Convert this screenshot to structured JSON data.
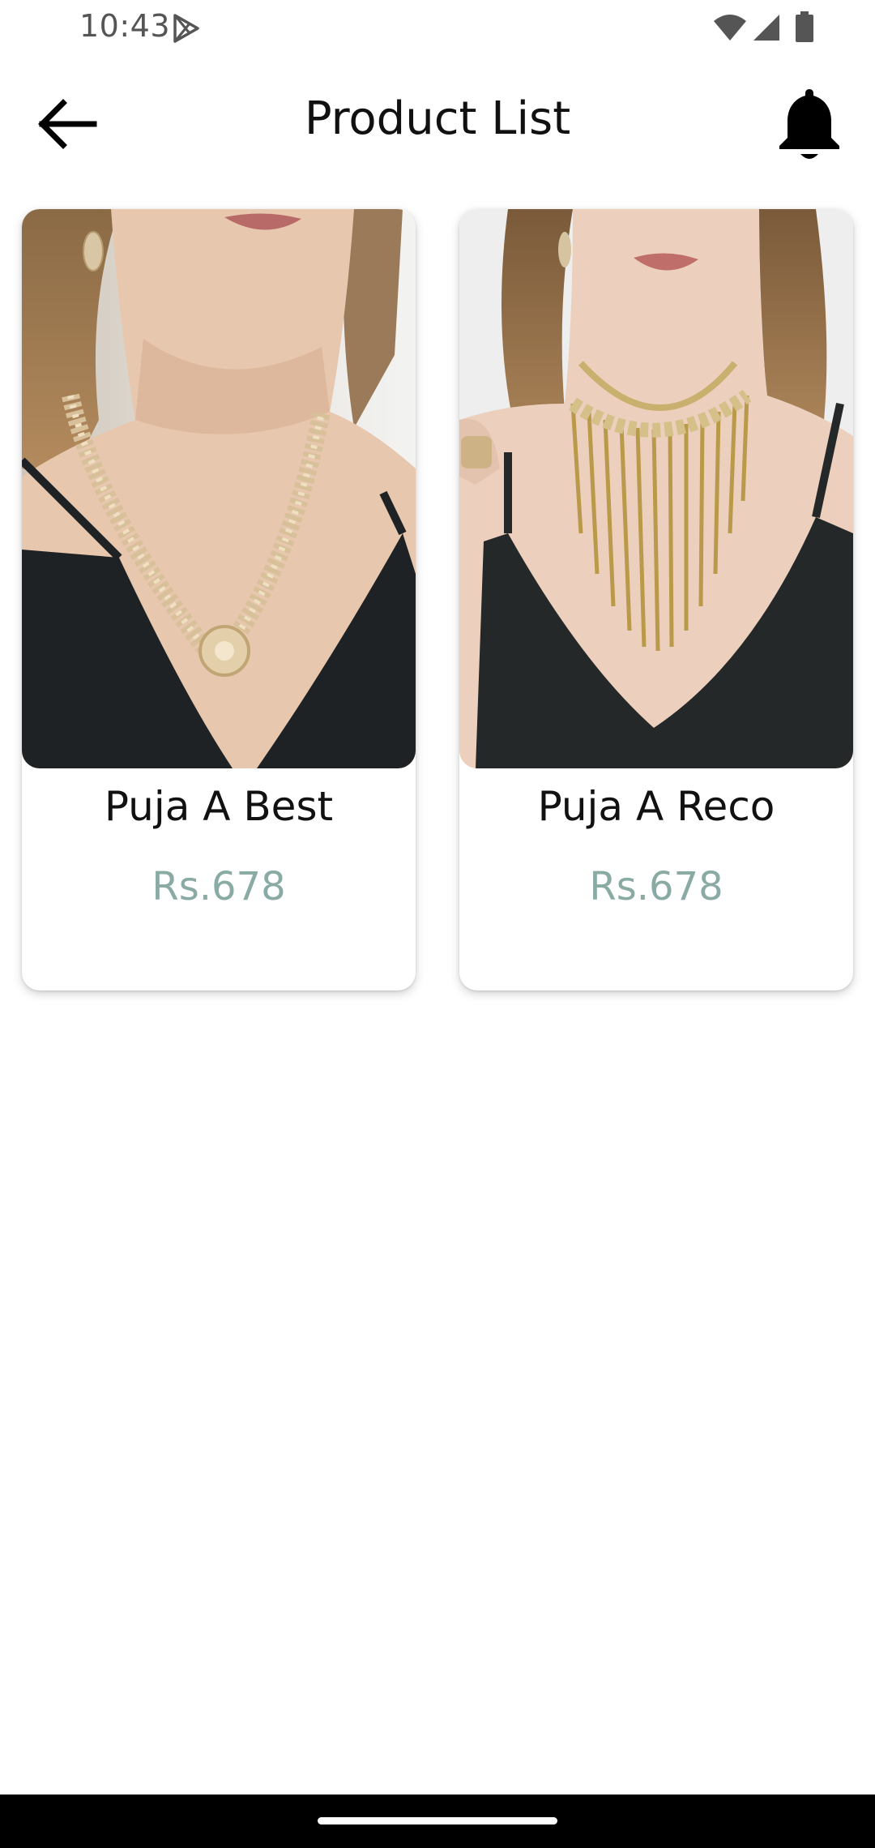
{
  "status_bar": {
    "time": "10:43",
    "icons": [
      "play-store-icon",
      "wifi-icon",
      "signal-icon",
      "battery-icon"
    ]
  },
  "app_bar": {
    "title": "Product List",
    "back_icon": "arrow-left-icon",
    "notification_icon": "bell-icon"
  },
  "products": [
    {
      "name": "Puja A Best",
      "price": "Rs.678",
      "image": "model-wearing-gold-crystal-flower-necklace"
    },
    {
      "name": "Puja A Reco",
      "price": "Rs.678",
      "image": "model-wearing-gold-fringe-chain-necklace"
    }
  ],
  "colors": {
    "price": "#8aaaa4",
    "title": "#111111",
    "nav_bar": "#000000"
  }
}
